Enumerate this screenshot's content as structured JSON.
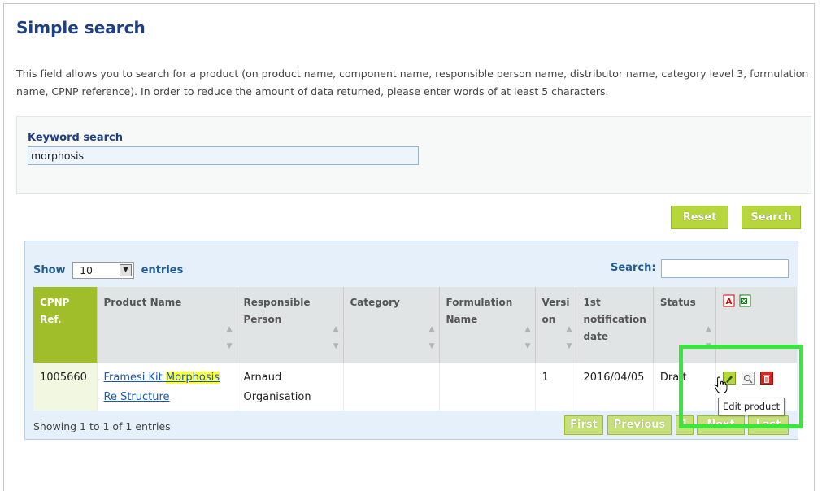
{
  "page": {
    "title": "Simple search",
    "description": "This field allows you to search for a product (on product name, component name, responsible person name, distributor name, category level 3, formulation name, CPNP reference). In order to reduce the amount of data returned, please enter words of at least 5 characters."
  },
  "keyword": {
    "label": "Keyword search",
    "value": "morphosis"
  },
  "buttons": {
    "reset": "Reset",
    "search": "Search"
  },
  "table_controls": {
    "show_label": "Show",
    "entries_value": "10",
    "entries_label": "entries",
    "search_label": "Search:",
    "search_value": ""
  },
  "table": {
    "columns": [
      "CPNP Ref.",
      "Product Name",
      "Responsible Person",
      "Category",
      "Formulation Name",
      "Version",
      "1st notification date",
      "Status"
    ],
    "column_lines": [
      [
        "CPNP",
        "Ref."
      ],
      [
        "Product Name"
      ],
      [
        "Responsible",
        "Person"
      ],
      [
        "Category"
      ],
      [
        "Formulation",
        "Name"
      ],
      [
        "Versi",
        "on"
      ],
      [
        "1st",
        "notification",
        "date"
      ],
      [
        "Status"
      ]
    ],
    "export_icons": [
      "pdf-export-icon",
      "excel-export-icon"
    ],
    "rows": [
      {
        "cpnp_ref": "1005660",
        "product_name_pre": "Framesi Kit ",
        "product_name_highlight": "Morphosis",
        "product_name_post": "Re Structure",
        "responsible_person": "Arnaud Organisation",
        "responsible_line1": "Arnaud",
        "responsible_line2": "Organisation",
        "category": "",
        "formulation_name": "",
        "version": "1",
        "first_notification_date": "2016/04/05",
        "status": "Draft",
        "actions": [
          "edit-icon",
          "view-icon",
          "delete-icon"
        ]
      }
    ]
  },
  "table_footer": {
    "info": "Showing 1 to 1 of 1 entries",
    "pagination": [
      "First",
      "Previous",
      "1",
      "Next",
      "Last"
    ]
  },
  "tooltip": "Edit product",
  "colors": {
    "title": "#1f3f83",
    "button": "#b6d63b",
    "highlight_box": "#35e83a",
    "search_highlight": "#ffff3d",
    "link": "#1a58b5"
  }
}
